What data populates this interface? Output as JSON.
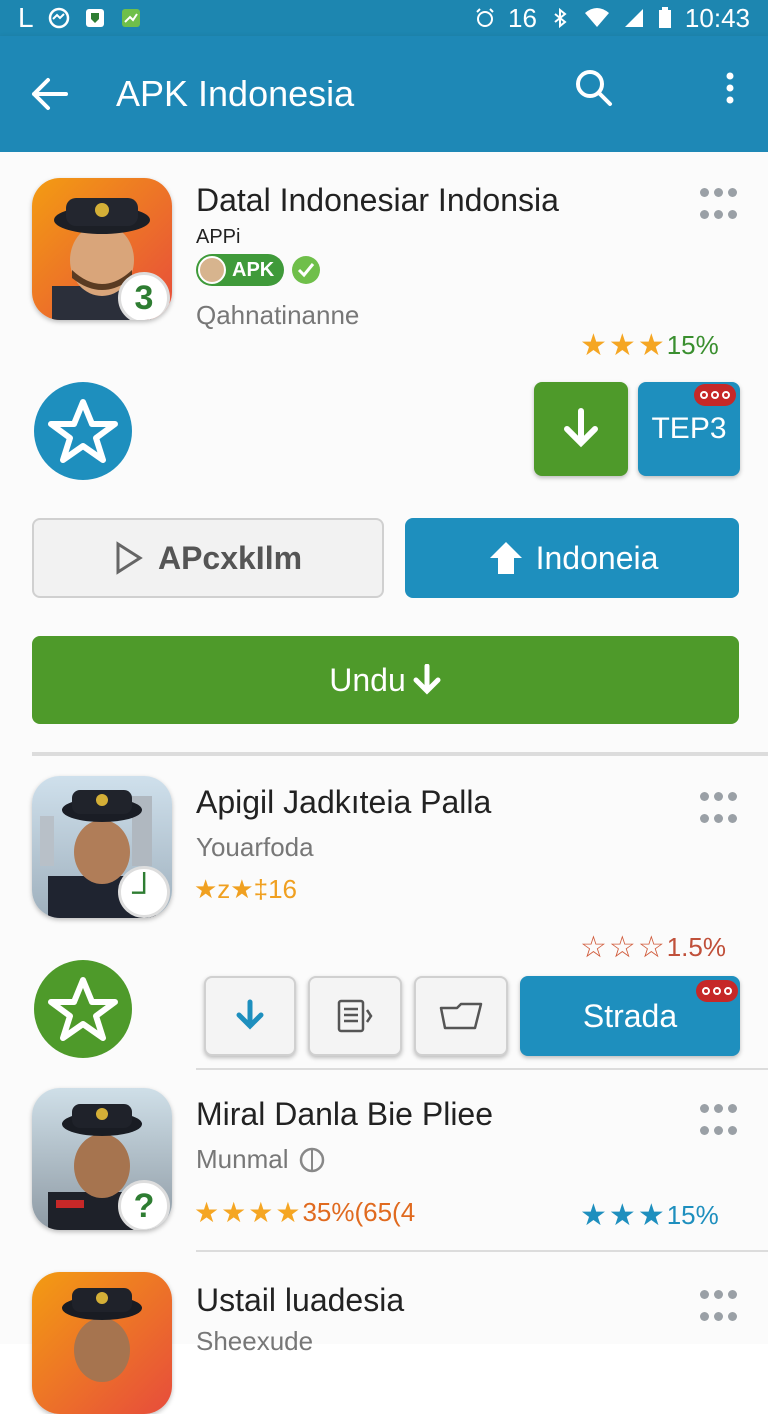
{
  "status_bar": {
    "left_glyph": "L",
    "signal_count": "16",
    "time": "10:43"
  },
  "app_bar": {
    "title": "APK Indonesia",
    "icons": [
      "back-arrow-icon",
      "search-icon",
      "overflow-menu-icon"
    ]
  },
  "featured": {
    "title": "Datal Indonesiar Indonsia",
    "subtitle_small": "APPi",
    "apk_chip": "APK",
    "developer": "Qahnatinanne",
    "icon_badge": "3",
    "rating_text": "15%",
    "rating_stars": 3,
    "action_tile_label": "TEP3",
    "secondary_button": "APcxkIlm",
    "primary_button": "Indoneia",
    "download_button": "Undu",
    "colors": {
      "accent_blue": "#1e8fbe",
      "green": "#4e9a2a",
      "star": "#f5a623"
    }
  },
  "list": [
    {
      "title": "Apigil Jadkıteia Palla",
      "developer": "Youarfoda",
      "inline_rating": "★z★‡16",
      "icon_badge": "┘",
      "rating_text": "1.5%",
      "rating_stars": 3,
      "rating_style": "outline-red",
      "action_label": "Strada"
    },
    {
      "title": "Miral Danla Bie Pliee",
      "developer": "Munmal",
      "inline_rating": "35%(65(4",
      "icon_badge": "?",
      "rating_text": "15%",
      "rating_stars": 3,
      "rating_style": "blue"
    },
    {
      "title": "Ustail luadesia",
      "developer": "Sheexude"
    }
  ]
}
